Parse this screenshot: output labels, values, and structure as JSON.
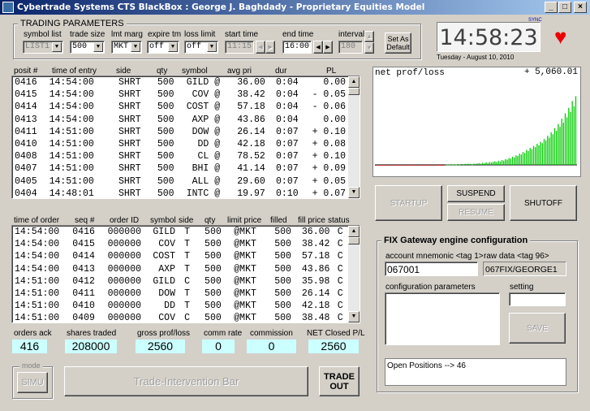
{
  "window": {
    "title": "Cybertrade Systems  CTS BlackBox : George J. Baghdady  - Proprietary Equities Model",
    "min": "_",
    "max": "□",
    "close": "×"
  },
  "params": {
    "title": "TRADING PARAMETERS",
    "symbol_list": {
      "label": "symbol list",
      "value": "LIST1"
    },
    "trade_size": {
      "label": "trade size",
      "value": "500"
    },
    "lmt_marg": {
      "label": "lmt marg",
      "value": "MKT"
    },
    "expire_tm": {
      "label": "expire tm",
      "value": "off"
    },
    "loss_limit": {
      "label": "loss limit",
      "value": "off"
    },
    "start_time": {
      "label": "start time",
      "value": "11:15"
    },
    "end_time": {
      "label": "end time",
      "value": "16:00"
    },
    "interval": {
      "label": "interval",
      "value": "180"
    },
    "set_default": "Set As Default"
  },
  "clock": {
    "time": "14:58:23",
    "date": "Tuesday - August 10, 2010",
    "sync": "SYNC"
  },
  "positions": {
    "headers": [
      "posit #",
      "time of entry",
      "side",
      "qty",
      "symbol",
      "avg pri",
      "dur",
      "PL"
    ],
    "rows": [
      [
        "0416",
        "14:54:00",
        "SHRT",
        "500",
        "GILD @",
        "36.00",
        "0:04",
        "0.00"
      ],
      [
        "0415",
        "14:54:00",
        "SHRT",
        "500",
        "COV @",
        "38.42",
        "0:04",
        "- 0.05"
      ],
      [
        "0414",
        "14:54:00",
        "SHRT",
        "500",
        "COST @",
        "57.18",
        "0:04",
        "- 0.06"
      ],
      [
        "0413",
        "14:54:00",
        "SHRT",
        "500",
        "AXP @",
        "43.86",
        "0:04",
        "0.00"
      ],
      [
        "0411",
        "14:51:00",
        "SHRT",
        "500",
        "DOW @",
        "26.14",
        "0:07",
        "+ 0.10"
      ],
      [
        "0410",
        "14:51:00",
        "SHRT",
        "500",
        "DD @",
        "42.18",
        "0:07",
        "+ 0.08"
      ],
      [
        "0408",
        "14:51:00",
        "SHRT",
        "500",
        "CL @",
        "78.52",
        "0:07",
        "+ 0.10"
      ],
      [
        "0407",
        "14:51:00",
        "SHRT",
        "500",
        "BHI @",
        "41.14",
        "0:07",
        "+ 0.09"
      ],
      [
        "0405",
        "14:51:00",
        "SHRT",
        "500",
        "ALL @",
        "29.60",
        "0:07",
        "+ 0.05"
      ],
      [
        "0404",
        "14:48:01",
        "SHRT",
        "500",
        "INTC @",
        "19.97",
        "0:10",
        "+ 0.07"
      ]
    ]
  },
  "orders": {
    "headers": [
      "time of order",
      "seq #",
      "order ID",
      "symbol",
      "side",
      "qty",
      "limit price",
      "filled",
      "fill price",
      "status"
    ],
    "rows": [
      [
        "14:54:00",
        "0416",
        "000000",
        "GILD",
        "T",
        "500",
        "@MKT",
        "500",
        "36.00",
        "C"
      ],
      [
        "14:54:00",
        "0415",
        "000000",
        "COV",
        "T",
        "500",
        "@MKT",
        "500",
        "38.42",
        "C"
      ],
      [
        "14:54:00",
        "0414",
        "000000",
        "COST",
        "T",
        "500",
        "@MKT",
        "500",
        "57.18",
        "C"
      ],
      [
        "14:54:00",
        "0413",
        "000000",
        "AXP",
        "T",
        "500",
        "@MKT",
        "500",
        "43.86",
        "C"
      ],
      [
        "14:51:00",
        "0412",
        "000000",
        "GILD",
        "C",
        "500",
        "@MKT",
        "500",
        "35.98",
        "C"
      ],
      [
        "14:51:00",
        "0411",
        "000000",
        "DOW",
        "T",
        "500",
        "@MKT",
        "500",
        "26.14",
        "C"
      ],
      [
        "14:51:00",
        "0410",
        "000000",
        "DD",
        "T",
        "500",
        "@MKT",
        "500",
        "42.18",
        "C"
      ],
      [
        "14:51:00",
        "0409",
        "000000",
        "COV",
        "C",
        "500",
        "@MKT",
        "500",
        "38.48",
        "C"
      ]
    ]
  },
  "stats": {
    "orders_ack": {
      "label": "orders ack",
      "value": "416"
    },
    "shares_traded": {
      "label": "shares traded",
      "value": "208000"
    },
    "gross_pl": {
      "label": "gross prof/loss",
      "value": "2560"
    },
    "comm_rate": {
      "label": "comm rate",
      "value": "0"
    },
    "commission": {
      "label": "commission",
      "value": "0"
    },
    "net_closed": {
      "label": "NET Closed P/L",
      "value": "2560"
    }
  },
  "mode": {
    "label": "mode",
    "button": "SIMU"
  },
  "intervention": "Trade-Intervention Bar",
  "trade_out": "TRADE OUT",
  "chart": {
    "title": "net prof/loss",
    "value_text": "+ 5,060.01",
    "colors": {
      "positive": "#00cc00",
      "negative": "#cc0000",
      "baseline": "#000000"
    }
  },
  "chart_data": {
    "type": "bar",
    "title": "net prof/loss",
    "xlabel": "",
    "ylabel": "",
    "ylim": [
      -600,
      5500
    ],
    "values": [
      -15,
      -20,
      -10,
      -25,
      -15,
      -10,
      -20,
      -30,
      -15,
      -10,
      -20,
      -15,
      -25,
      -10,
      -15,
      -20,
      -10,
      -15,
      -5,
      -10,
      -20,
      -15,
      -10,
      -5,
      -10,
      -15,
      -20,
      -10,
      -5,
      -15,
      -10,
      -20,
      -30,
      -10,
      -15,
      -10,
      -5,
      -10,
      -15,
      -10,
      10,
      20,
      30,
      15,
      25,
      40,
      30,
      50,
      35,
      60,
      45,
      70,
      55,
      80,
      65,
      40,
      90,
      70,
      100,
      120,
      90,
      150,
      110,
      180,
      140,
      200,
      170,
      220,
      260,
      210,
      300,
      250,
      350,
      310,
      420,
      380,
      500,
      460,
      600,
      540,
      700,
      650,
      820,
      760,
      940,
      880,
      1100,
      1020,
      1250,
      1150,
      1400,
      1300,
      1550,
      1450,
      1700,
      1600,
      1900,
      1800,
      2150,
      2000,
      2400,
      2250,
      2700,
      2500,
      3000,
      2800,
      3400,
      3100,
      3800,
      3500,
      4200,
      3900,
      4700,
      4300,
      5060
    ],
    "grid": false
  },
  "controls": {
    "startup": "STARTUP",
    "suspend": "SUSPEND",
    "resume": "RESUME",
    "shutoff": "SHUTOFF"
  },
  "fix": {
    "title": "FIX Gateway engine configuration",
    "account_label": "account mnemonic <tag 1>",
    "account_value": "067001",
    "raw_label": "raw data <tag 96>",
    "raw_value": "067FIX/GEORGE1",
    "config_label": "configuration parameters",
    "setting_label": "setting",
    "save": "SAVE",
    "open_positions": "Open Positions -->  46"
  }
}
